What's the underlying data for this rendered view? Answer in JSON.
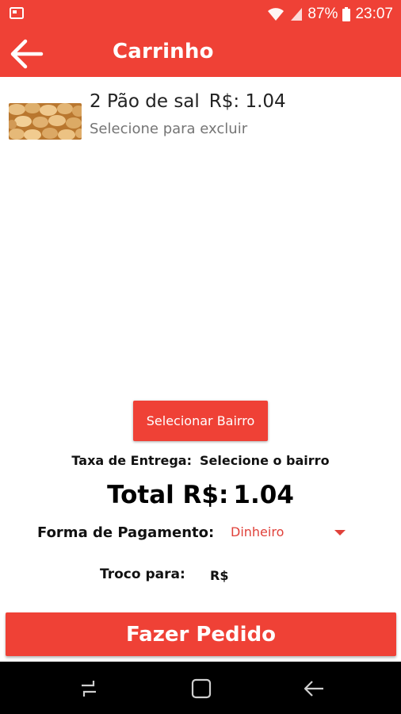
{
  "status_bar": {
    "battery": "87%",
    "time": "23:07"
  },
  "app_bar": {
    "title": "Carrinho",
    "back_icon": "arrow-left-icon"
  },
  "cart": {
    "items": [
      {
        "quantity_name": "2 Pão de sal",
        "price": "R$: 1.04",
        "hint": "Selecione para excluir",
        "thumbnail": "bread-rolls-image"
      }
    ]
  },
  "delivery": {
    "select_button": "Selecionar Bairro",
    "fee_label": "Taxa de Entrega:",
    "fee_value": "Selecione o bairro"
  },
  "total": {
    "label": "Total R$:",
    "value": "1.04"
  },
  "payment": {
    "label": "Forma de Pagamento:",
    "selected": "Dinheiro"
  },
  "change": {
    "label": "Troco para:",
    "placeholder": "R$"
  },
  "order_button": "Fazer Pedido",
  "colors": {
    "accent": "#ef4136",
    "dropdown_text": "#e0413a"
  },
  "nav_bar": {
    "icons": [
      "recent-apps-icon",
      "home-icon",
      "back-icon"
    ]
  }
}
